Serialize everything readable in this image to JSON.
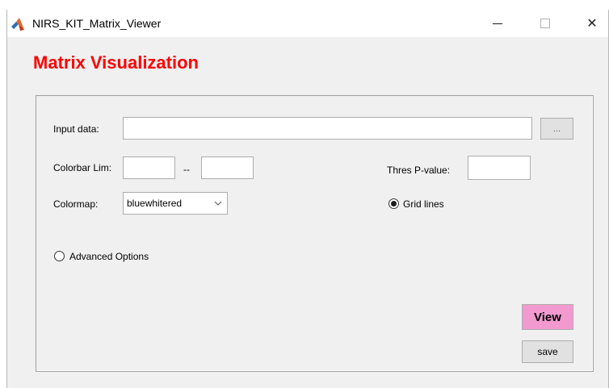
{
  "window": {
    "title": "NIRS_KIT_Matrix_Viewer",
    "icon": "matlab-logo-icon",
    "controls": [
      "minimize-icon",
      "maximize-icon",
      "close-icon"
    ],
    "close_glyph": "✕"
  },
  "heading": "Matrix Visualization",
  "form": {
    "input_data_label": "Input data:",
    "input_data_value": "",
    "browse_label": "...",
    "colorbar_label": "Colorbar Lim:",
    "colorbar_min": "",
    "colorbar_separator": "--",
    "colorbar_max": "",
    "thres_label": "Thres P-value:",
    "thres_value": "",
    "colormap_label": "Colormap:",
    "colormap_selected": "bluewhitered",
    "grid_lines_label": "Grid lines",
    "grid_lines_selected": true,
    "advanced_label": "Advanced Options",
    "advanced_selected": false
  },
  "buttons": {
    "view_label": "View",
    "save_label": "save"
  },
  "colors": {
    "heading": "#ff0000",
    "view_button": "#f29ad0",
    "window_bg": "#f0f0f0"
  }
}
